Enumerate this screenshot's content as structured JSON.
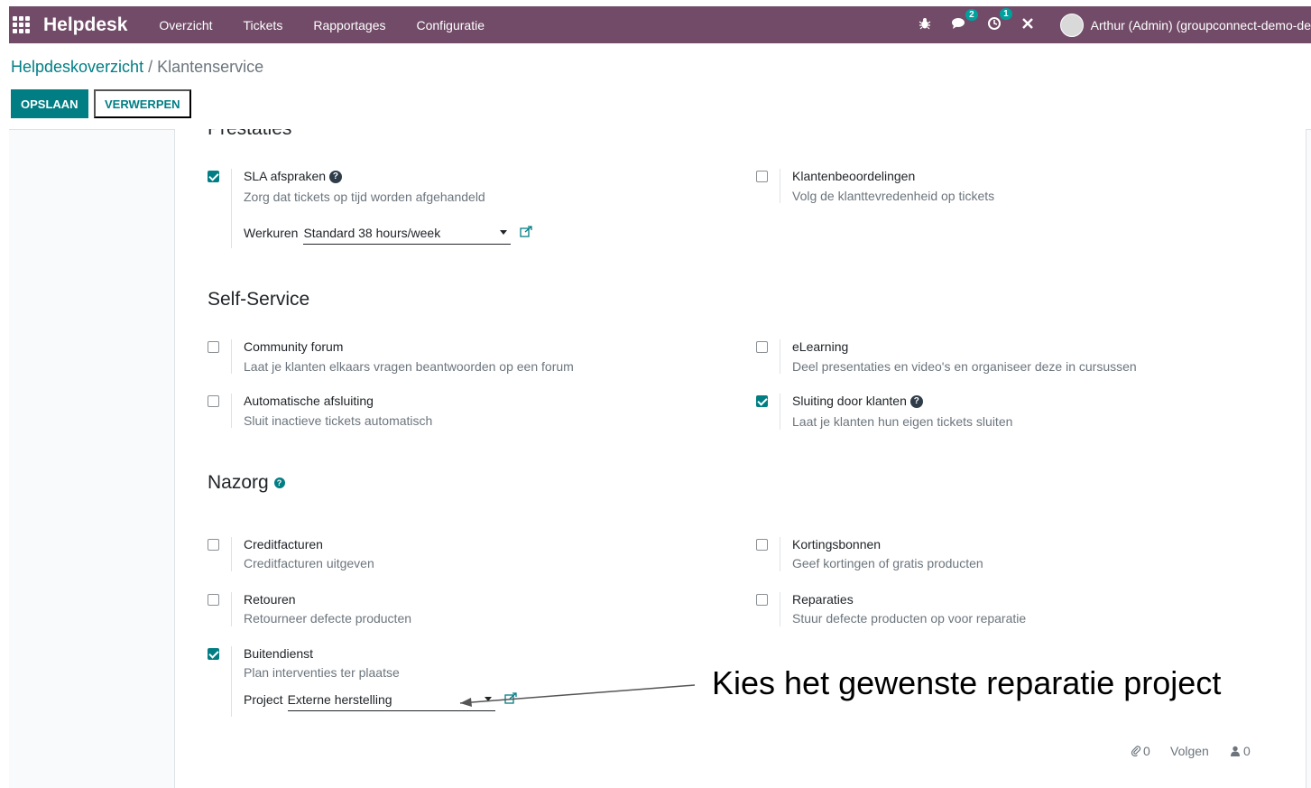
{
  "topbar": {
    "app_name": "Helpdesk",
    "menu": [
      "Overzicht",
      "Tickets",
      "Rapportages",
      "Configuratie"
    ],
    "chat_badge": "2",
    "activity_badge": "1",
    "user_name": "Arthur (Admin) (groupconnect-demo-de"
  },
  "breadcrumb": {
    "parent": "Helpdeskoverzicht",
    "separator": "/",
    "current": "Klantenservice"
  },
  "buttons": {
    "save": "OPSLAAN",
    "discard": "VERWERPEN"
  },
  "sections": {
    "prestaties": {
      "title": "Prestaties",
      "sla": {
        "title": "SLA afspraken",
        "desc": "Zorg dat tickets op tijd worden afgehandeld",
        "checked": true,
        "field_label": "Werkuren",
        "field_value": "Standard 38 hours/week"
      },
      "ratings": {
        "title": "Klantenbeoordelingen",
        "desc": "Volg de klanttevredenheid op tickets",
        "checked": false
      }
    },
    "self_service": {
      "title": "Self-Service",
      "forum": {
        "title": "Community forum",
        "desc": "Laat je klanten elkaars vragen beantwoorden op een forum",
        "checked": false
      },
      "elearning": {
        "title": "eLearning",
        "desc": "Deel presentaties en video's en organiseer deze in cursussen",
        "checked": false
      },
      "autoclose": {
        "title": "Automatische afsluiting",
        "desc": "Sluit inactieve tickets automatisch",
        "checked": false
      },
      "customer_close": {
        "title": "Sluiting door klanten",
        "desc": "Laat je klanten hun eigen tickets sluiten",
        "checked": true
      }
    },
    "nazorg": {
      "title": "Nazorg",
      "credit": {
        "title": "Creditfacturen",
        "desc": "Creditfacturen uitgeven",
        "checked": false
      },
      "coupons": {
        "title": "Kortingsbonnen",
        "desc": "Geef kortingen of gratis producten",
        "checked": false
      },
      "returns": {
        "title": "Retouren",
        "desc": "Retourneer defecte producten",
        "checked": false
      },
      "repairs": {
        "title": "Reparaties",
        "desc": "Stuur defecte producten op voor reparatie",
        "checked": false
      },
      "fieldservice": {
        "title": "Buitendienst",
        "desc": "Plan interventies ter plaatse",
        "checked": true,
        "field_label": "Project",
        "field_value": "Externe herstelling"
      }
    }
  },
  "chatter": {
    "attachments": "0",
    "follow": "Volgen",
    "followers": "0"
  },
  "annotation": "Kies het gewenste reparatie project",
  "colors": {
    "topbar": "#714b67",
    "primary": "#017e84"
  }
}
